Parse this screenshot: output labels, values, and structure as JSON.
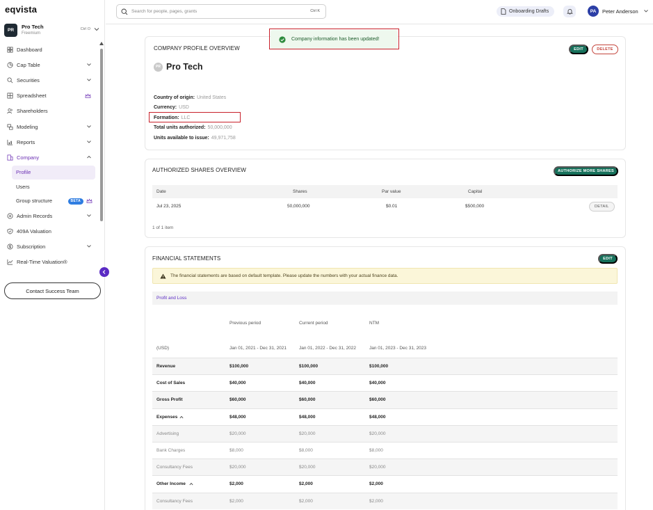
{
  "app": {
    "logo": "eqvista"
  },
  "org": {
    "avatar": "PR",
    "name": "Pro Tech",
    "plan": "Freemium",
    "shortcut": "Ctrl O"
  },
  "sidebar": {
    "items": [
      {
        "label": "Dashboard",
        "icon": "dashboard-icon",
        "chevron": false
      },
      {
        "label": "Cap Table",
        "icon": "pie-chart-icon",
        "chevron": true
      },
      {
        "label": "Securities",
        "icon": "securities-icon",
        "chevron": true
      },
      {
        "label": "Spreadsheet",
        "icon": "spreadsheet-icon",
        "crown": true
      },
      {
        "label": "Shareholders",
        "icon": "users-icon",
        "chevron": false
      },
      {
        "label": "Modeling",
        "icon": "modeling-icon",
        "chevron": true
      },
      {
        "label": "Reports",
        "icon": "reports-icon",
        "chevron": true
      },
      {
        "label": "Company",
        "icon": "company-icon",
        "chevron": true,
        "expanded": true,
        "active": true
      }
    ],
    "company_sub": [
      {
        "label": "Profile",
        "selected": true
      },
      {
        "label": "Users"
      },
      {
        "label": "Group structure",
        "badge": "BETA",
        "crown": true
      }
    ],
    "items_after": [
      {
        "label": "Admin Records",
        "icon": "admin-icon",
        "chevron": true
      },
      {
        "label": "409A Valuation",
        "icon": "shield-check-icon",
        "chevron": false
      },
      {
        "label": "Subscription",
        "icon": "dollar-icon",
        "chevron": true
      },
      {
        "label": "Real-Time Valuation®",
        "icon": "trend-icon",
        "chevron": false
      }
    ],
    "contact_label": "Contact Success Team"
  },
  "topbar": {
    "search_placeholder": "Search for people, pages, grants",
    "search_shortcut": "Ctrl K",
    "drafts_label": "Onboarding Drafts",
    "user_initials": "PA",
    "user_name": "Peter Anderson"
  },
  "toast": {
    "message": "Company information has been updated!"
  },
  "profile": {
    "title": "COMPANY PROFILE OVERVIEW",
    "edit_label": "EDIT",
    "delete_label": "DELETE",
    "avatar": "PR",
    "company_name": "Pro Tech",
    "fields": [
      {
        "key": "Country of origin:",
        "value": "United States"
      },
      {
        "key": "Currency:",
        "value": "USD"
      },
      {
        "key": "Formation:",
        "value": "LLC"
      },
      {
        "key": "Total units authorized:",
        "value": "50,000,000"
      },
      {
        "key": "Units available to issue:",
        "value": "49,971,758"
      }
    ]
  },
  "shares": {
    "title": "AUTHORIZED SHARES OVERVIEW",
    "authorize_label": "AUTHORIZE MORE SHARES",
    "columns": [
      "Date",
      "Shares",
      "Par value",
      "Capital"
    ],
    "rows": [
      {
        "date": "Jul 23, 2025",
        "shares": "50,000,000",
        "par": "$0.01",
        "capital": "$500,000",
        "action": "DETAIL"
      }
    ],
    "pager": "1 of 1 item"
  },
  "financials": {
    "title": "FINANCIAL STATEMENTS",
    "edit_label": "EDIT",
    "warning": "The financial statements are based on default template. Please update the numbers with your actual finance data.",
    "tab": "Profit and Loss",
    "period_headers": [
      "Previous period",
      "Current period",
      "NTM"
    ],
    "unit_label": "(USD)",
    "period_ranges": [
      "Jan 01, 2021 - Dec 31, 2021",
      "Jan 01, 2022 - Dec 31, 2022",
      "Jan 01, 2023 - Dec 31, 2023"
    ],
    "rows": [
      {
        "label": "Revenue",
        "values": [
          "$100,000",
          "$100,000",
          "$100,000"
        ],
        "style": "bold",
        "shade": true
      },
      {
        "label": "Cost of Sales",
        "values": [
          "$40,000",
          "$40,000",
          "$40,000"
        ],
        "style": "bold",
        "shade": false
      },
      {
        "label": "Gross Profit",
        "values": [
          "$60,000",
          "$60,000",
          "$60,000"
        ],
        "style": "bold",
        "shade": true
      },
      {
        "label": "Expenses",
        "values": [
          "$48,000",
          "$48,000",
          "$48,000"
        ],
        "style": "bold",
        "shade": false,
        "caret": true
      },
      {
        "label": "Advertising",
        "values": [
          "$20,000",
          "$20,000",
          "$20,000"
        ],
        "style": "light",
        "shade": true
      },
      {
        "label": "Bank Charges",
        "values": [
          "$8,000",
          "$8,000",
          "$8,000"
        ],
        "style": "light",
        "shade": false
      },
      {
        "label": "Consultancy Fees",
        "values": [
          "$20,000",
          "$20,000",
          "$20,000"
        ],
        "style": "light",
        "shade": true
      },
      {
        "label": "Other Income",
        "values": [
          "$2,000",
          "$2,000",
          "$2,000"
        ],
        "style": "bold",
        "shade": false,
        "caret": true
      },
      {
        "label": "Consultancy Fees",
        "values": [
          "$2,000",
          "$2,000",
          "$2,000"
        ],
        "style": "light",
        "shade": true
      }
    ]
  },
  "colors": {
    "accent": "#6b2fb3",
    "primary_button": "#16715b",
    "danger": "#c4453c",
    "highlight": "#c8202a"
  }
}
